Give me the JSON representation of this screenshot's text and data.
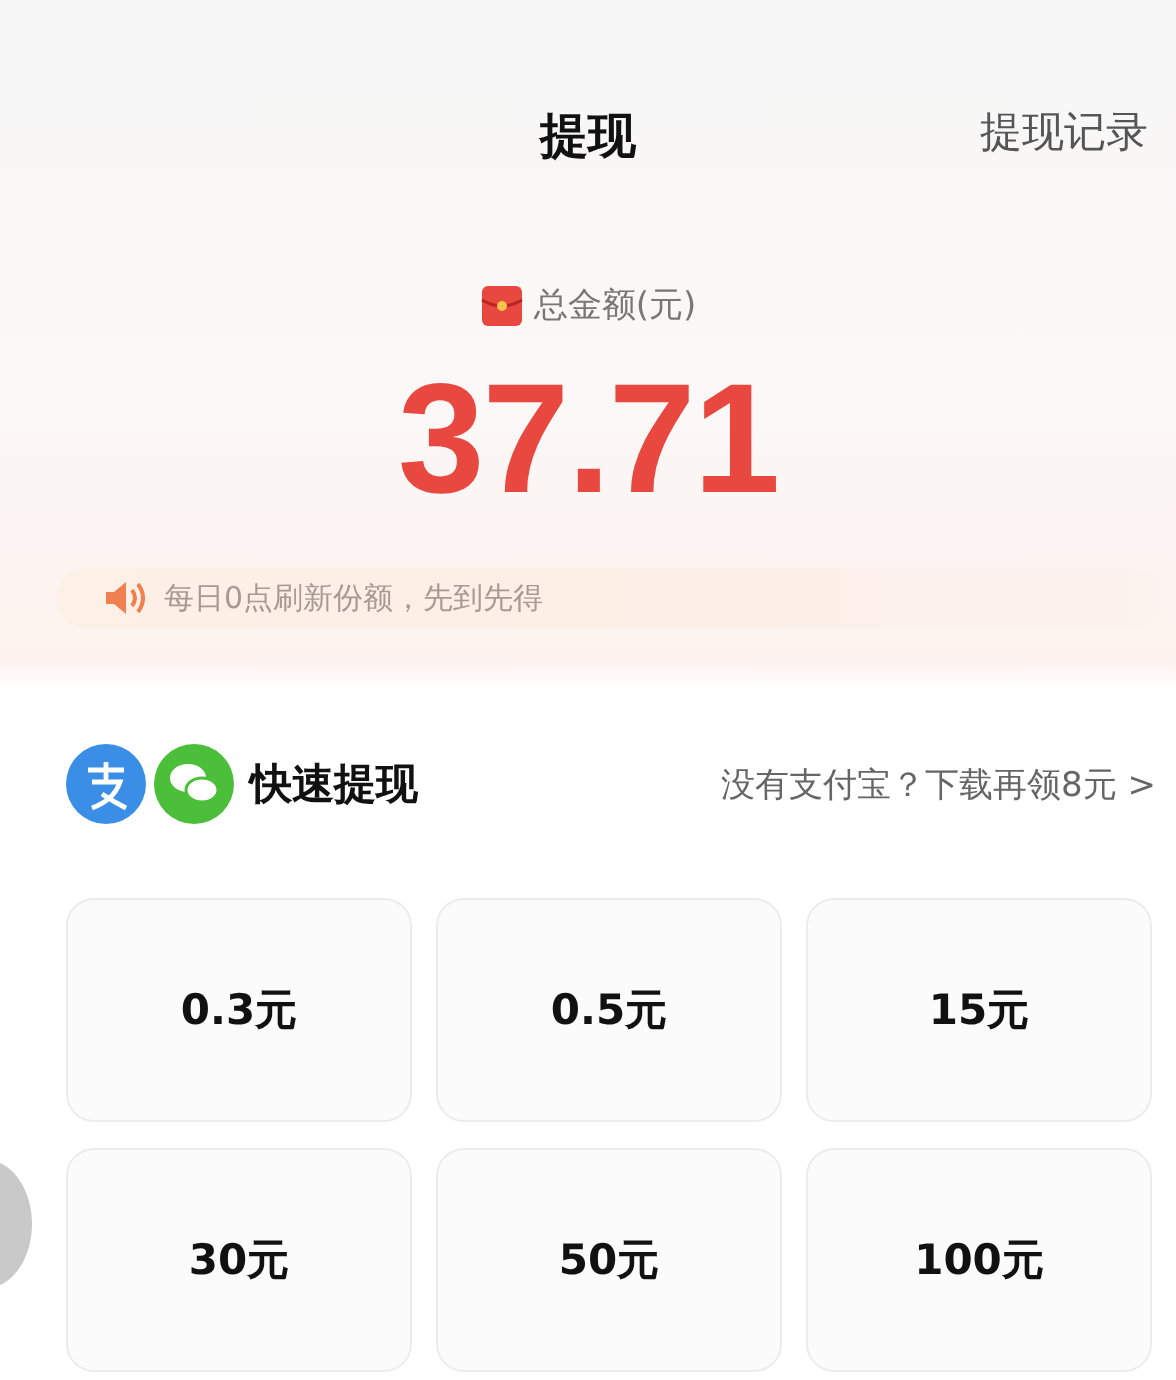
{
  "header": {
    "title": "提现",
    "link": "提现记录"
  },
  "balance": {
    "label": "总金额(元)",
    "amount": "37.71"
  },
  "notice": {
    "text": "每日0点刷新份额，先到先得"
  },
  "quick": {
    "title": "快速提现",
    "promo": "没有支付宝？下载再领8元 >"
  },
  "options": [
    {
      "label": "0.3元"
    },
    {
      "label": "0.5元"
    },
    {
      "label": "15元"
    },
    {
      "label": "30元"
    },
    {
      "label": "50元"
    },
    {
      "label": "100元"
    }
  ]
}
